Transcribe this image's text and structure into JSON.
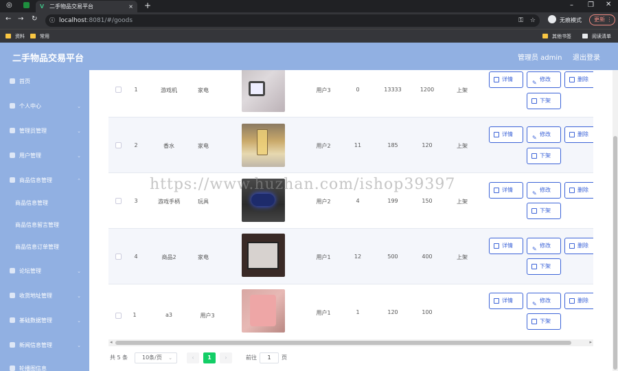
{
  "browser": {
    "tab_title": "二手物品交易平台",
    "url_host": "localhost",
    "url_rest": ":8081/#/goods",
    "incognito_label": "无痕模式",
    "update_label": "更新",
    "bookmarks": [
      "资料",
      "常用"
    ],
    "bookmarks_right": [
      "其他书签",
      "阅读清单"
    ]
  },
  "header": {
    "brand": "二手物品交易平台",
    "admin": "管理员 admin",
    "logout": "退出登录"
  },
  "sidebar": {
    "items": [
      {
        "label": "首页"
      },
      {
        "label": "个人中心"
      },
      {
        "label": "管理员管理"
      },
      {
        "label": "用户管理"
      },
      {
        "label": "商品信息管理"
      },
      {
        "label": "商品信息管理"
      },
      {
        "label": "商品信息留言管理"
      },
      {
        "label": "商品信息订单管理"
      },
      {
        "label": "论坛管理"
      },
      {
        "label": "收货地址管理"
      },
      {
        "label": "基础数据管理"
      },
      {
        "label": "新闻信息管理"
      },
      {
        "label": "轮播图信息"
      }
    ]
  },
  "table": {
    "rows": [
      {
        "index": "1",
        "name": "游戏机",
        "category": "家电",
        "thumb": "gameconsole",
        "user": "用户3",
        "c1": "0",
        "c2": "13333",
        "c3": "1200",
        "status": "上架"
      },
      {
        "index": "2",
        "name": "香水",
        "category": "家电",
        "thumb": "perfume",
        "user": "用户2",
        "c1": "11",
        "c2": "185",
        "c3": "120",
        "status": "上架"
      },
      {
        "index": "3",
        "name": "游戏手柄",
        "category": "玩具",
        "thumb": "gamepad",
        "user": "用户2",
        "c1": "4",
        "c2": "199",
        "c3": "150",
        "status": "上架"
      },
      {
        "index": "4",
        "name": "商品2",
        "category": "家电",
        "thumb": "fridge",
        "user": "用户1",
        "c1": "12",
        "c2": "500",
        "c3": "400",
        "status": "上架"
      },
      {
        "index": "1",
        "name": "a3",
        "category": "用户3",
        "thumb": "clothes",
        "user": "用户1",
        "c1": "1",
        "c2": "120",
        "c3": "100",
        "status": ""
      }
    ],
    "actions": {
      "detail": "详情",
      "edit": "修改",
      "delete": "删除",
      "off_shelf": "下架"
    }
  },
  "pagination": {
    "total": "共 5 条",
    "page_size": "10条/页",
    "current": "1",
    "goto_label": "前往",
    "goto_value": "1",
    "page_suffix": "页"
  },
  "watermark": "https://www.huzhan.com/ishop39397",
  "colors": {
    "header": "#91b0e2",
    "accent": "#3a62d7",
    "pager_active": "#13ce66"
  }
}
